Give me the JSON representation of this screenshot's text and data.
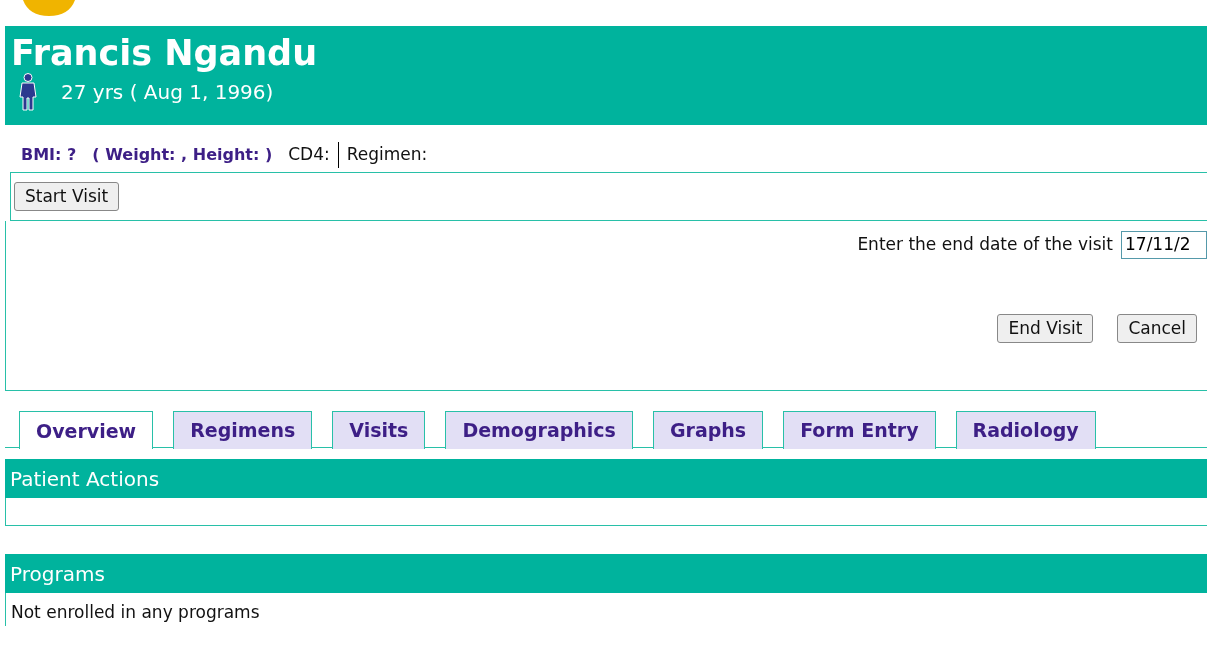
{
  "patient": {
    "name": "Francis Ngandu",
    "age": "27 yrs ( Aug 1, 1996)"
  },
  "summary": {
    "bmi": "BMI: ?",
    "weight_height": "( Weight: , Height: )",
    "cd4": "CD4:",
    "regimen": "Regimen:"
  },
  "start_visit": {
    "button": "Start Visit"
  },
  "end_visit": {
    "label": "Enter the end date of the visit",
    "date": "17/11/2",
    "buttons": [
      "End Visit",
      "Cancel"
    ]
  },
  "tabs": [
    {
      "label": "Overview",
      "selected": true
    },
    {
      "label": "Regimens",
      "selected": false
    },
    {
      "label": "Visits",
      "selected": false
    },
    {
      "label": "Demographics",
      "selected": false
    },
    {
      "label": "Graphs",
      "selected": false
    },
    {
      "label": "Form Entry",
      "selected": false
    },
    {
      "label": "Radiology",
      "selected": false
    }
  ],
  "sections": [
    {
      "title": "Patient Actions"
    },
    {
      "title": "Programs",
      "text": "Not enrolled in any programs"
    }
  ]
}
